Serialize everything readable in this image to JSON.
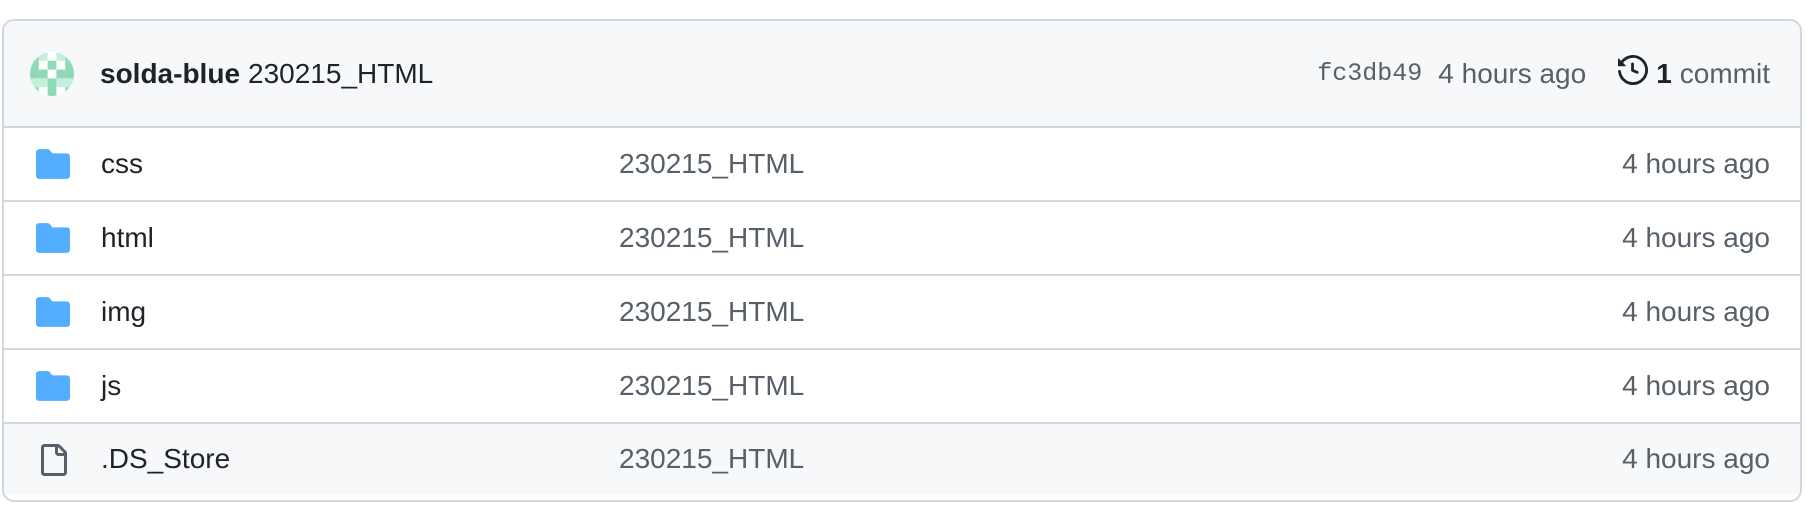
{
  "header": {
    "author": "solda-blue",
    "message": "230215_HTML",
    "sha": "fc3db49",
    "time": "4 hours ago",
    "commit_count": "1",
    "commit_word": "commit",
    "avatar_color": "#8fd9b6",
    "history_icon": "history-icon"
  },
  "files": [
    {
      "name": "css",
      "type": "folder",
      "message": "230215_HTML",
      "time": "4 hours ago"
    },
    {
      "name": "html",
      "type": "folder",
      "message": "230215_HTML",
      "time": "4 hours ago"
    },
    {
      "name": "img",
      "type": "folder",
      "message": "230215_HTML",
      "time": "4 hours ago"
    },
    {
      "name": "js",
      "type": "folder",
      "message": "230215_HTML",
      "time": "4 hours ago"
    },
    {
      "name": ".DS_Store",
      "type": "file",
      "message": "230215_HTML",
      "time": "4 hours ago"
    }
  ],
  "colors": {
    "folder": "#54aeff",
    "file_outline": "#57606a",
    "border": "#d0d7de",
    "header_bg": "#f6f8fa"
  }
}
